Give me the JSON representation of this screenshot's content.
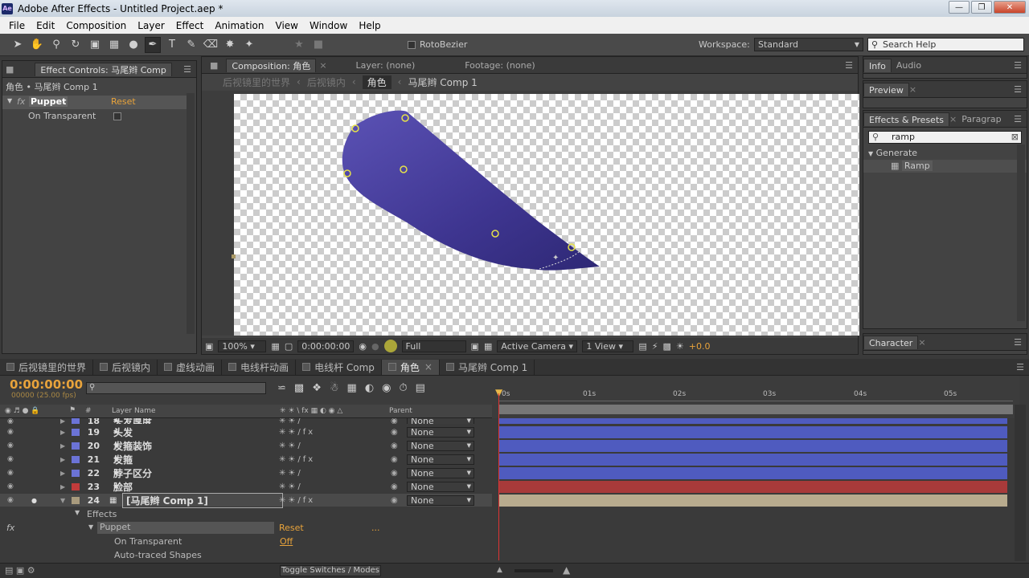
{
  "window": {
    "title": "Adobe After Effects - Untitled Project.aep *",
    "logo": "Ae"
  },
  "menu": [
    "File",
    "Edit",
    "Composition",
    "Layer",
    "Effect",
    "Animation",
    "View",
    "Window",
    "Help"
  ],
  "toolbar": {
    "rotobezier_label": "RotoBezier",
    "workspace_label": "Workspace:",
    "workspace_value": "Standard",
    "search_placeholder": "Search Help"
  },
  "effect_controls": {
    "tab_label": "Effect Controls: 马尾辫 Comp",
    "breadcrumb": "角色 • 马尾辫 Comp 1",
    "effect_name": "Puppet",
    "reset": "Reset",
    "prop_label": "On Transparent"
  },
  "composition": {
    "tab_label": "Composition: 角色",
    "layer_tab": "Layer: (none)",
    "footage_tab": "Footage: (none)",
    "crumbs": [
      "后视镜里的世界",
      "后视镜内",
      "角色",
      "马尾辫 Comp 1"
    ],
    "zoom": "100%",
    "timecode": "0:00:00:00",
    "resolution": "Full",
    "camera": "Active Camera",
    "views": "1 View",
    "exposure": "+0.0"
  },
  "right_panels": {
    "info_tabs": [
      "Info",
      "Audio"
    ],
    "preview": "Preview",
    "effects_tab": "Effects & Presets",
    "paragraph_tab": "Paragrap",
    "search_value": "ramp",
    "category": "Generate",
    "item": "Ramp",
    "character": "Character"
  },
  "timeline": {
    "tabs": [
      "后视镜里的世界",
      "后视镜内",
      "虚线动画",
      "电线杆动画",
      "电线杆 Comp",
      "角色",
      "马尾辫 Comp 1"
    ],
    "active_tab_index": 5,
    "timecode": "0:00:00:00",
    "fps": "00000 (25.00 fps)",
    "col_layer_name": "Layer Name",
    "col_parent": "Parent",
    "col_hash": "#",
    "ruler": [
      "0s",
      "01s",
      "02s",
      "03s",
      "04s",
      "05s"
    ],
    "layers": [
      {
        "num": "18",
        "name": "头发厚度",
        "color": "#6b73d6",
        "bar": "#4f5bbf"
      },
      {
        "num": "19",
        "name": "头发",
        "color": "#6b73d6",
        "bar": "#4f5bbf"
      },
      {
        "num": "20",
        "name": "发箍装饰",
        "color": "#6b73d6",
        "bar": "#4f5bbf"
      },
      {
        "num": "21",
        "name": "发箍",
        "color": "#6b73d6",
        "bar": "#4f5bbf"
      },
      {
        "num": "22",
        "name": "脖子区分",
        "color": "#6b73d6",
        "bar": "#4f5bbf"
      },
      {
        "num": "23",
        "name": "脸部",
        "color": "#c23b3b",
        "bar": "#a83a3a"
      },
      {
        "num": "24",
        "name": "[马尾辫 Comp 1]",
        "color": "#a89a7d",
        "bar": "#b8ab8e"
      }
    ],
    "parent_value": "None",
    "effects_label": "Effects",
    "puppet_label": "Puppet",
    "reset_label": "Reset",
    "dots": "...",
    "on_transparent": "On Transparent",
    "off_value": "Off",
    "auto_traced": "Auto-traced Shapes",
    "toggle_label": "Toggle Switches / Modes"
  },
  "colors": {
    "accent": "#e8a33b",
    "shape": "#4b40a0"
  }
}
